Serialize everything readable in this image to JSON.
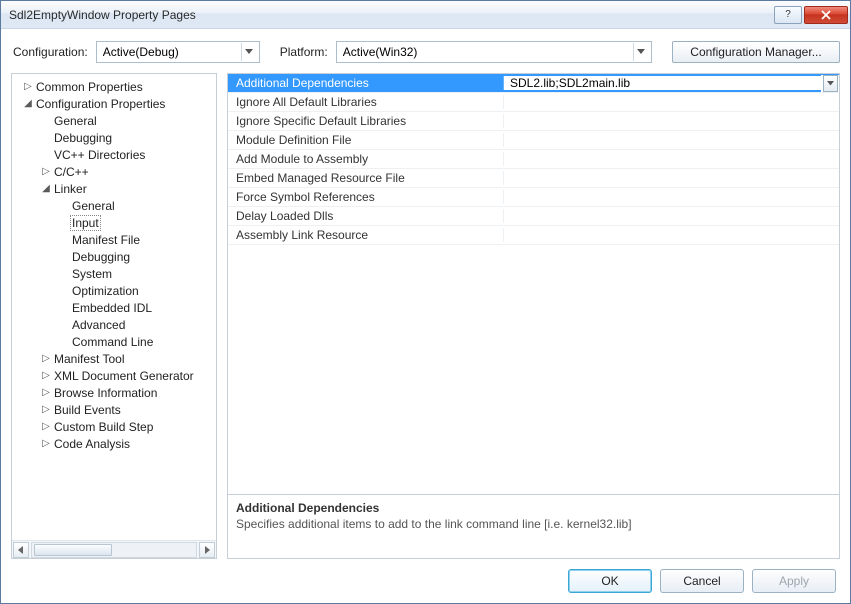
{
  "window": {
    "title": "Sdl2EmptyWindow Property Pages"
  },
  "toprow": {
    "config_label": "Configuration:",
    "config_value": "Active(Debug)",
    "platform_label": "Platform:",
    "platform_value": "Active(Win32)",
    "manager_button": "Configuration Manager..."
  },
  "tree": [
    {
      "depth": 0,
      "exp": "▷",
      "label": "Common Properties"
    },
    {
      "depth": 0,
      "exp": "◢",
      "label": "Configuration Properties"
    },
    {
      "depth": 1,
      "exp": "",
      "label": "General"
    },
    {
      "depth": 1,
      "exp": "",
      "label": "Debugging"
    },
    {
      "depth": 1,
      "exp": "",
      "label": "VC++ Directories"
    },
    {
      "depth": 1,
      "exp": "▷",
      "label": "C/C++"
    },
    {
      "depth": 1,
      "exp": "◢",
      "label": "Linker"
    },
    {
      "depth": 2,
      "exp": "",
      "label": "General"
    },
    {
      "depth": 2,
      "exp": "",
      "label": "Input",
      "selected": true
    },
    {
      "depth": 2,
      "exp": "",
      "label": "Manifest File"
    },
    {
      "depth": 2,
      "exp": "",
      "label": "Debugging"
    },
    {
      "depth": 2,
      "exp": "",
      "label": "System"
    },
    {
      "depth": 2,
      "exp": "",
      "label": "Optimization"
    },
    {
      "depth": 2,
      "exp": "",
      "label": "Embedded IDL"
    },
    {
      "depth": 2,
      "exp": "",
      "label": "Advanced"
    },
    {
      "depth": 2,
      "exp": "",
      "label": "Command Line"
    },
    {
      "depth": 1,
      "exp": "▷",
      "label": "Manifest Tool"
    },
    {
      "depth": 1,
      "exp": "▷",
      "label": "XML Document Generator"
    },
    {
      "depth": 1,
      "exp": "▷",
      "label": "Browse Information"
    },
    {
      "depth": 1,
      "exp": "▷",
      "label": "Build Events"
    },
    {
      "depth": 1,
      "exp": "▷",
      "label": "Custom Build Step"
    },
    {
      "depth": 1,
      "exp": "▷",
      "label": "Code Analysis"
    }
  ],
  "grid": [
    {
      "label": "Additional Dependencies",
      "value": "SDL2.lib;SDL2main.lib",
      "selected": true,
      "dropdown": true
    },
    {
      "label": "Ignore All Default Libraries",
      "value": ""
    },
    {
      "label": "Ignore Specific Default Libraries",
      "value": ""
    },
    {
      "label": "Module Definition File",
      "value": ""
    },
    {
      "label": "Add Module to Assembly",
      "value": ""
    },
    {
      "label": "Embed Managed Resource File",
      "value": ""
    },
    {
      "label": "Force Symbol References",
      "value": ""
    },
    {
      "label": "Delay Loaded Dlls",
      "value": ""
    },
    {
      "label": "Assembly Link Resource",
      "value": ""
    }
  ],
  "help": {
    "name": "Additional Dependencies",
    "desc": "Specifies additional items to add to the link command line [i.e. kernel32.lib]"
  },
  "footer": {
    "ok": "OK",
    "cancel": "Cancel",
    "apply": "Apply"
  }
}
